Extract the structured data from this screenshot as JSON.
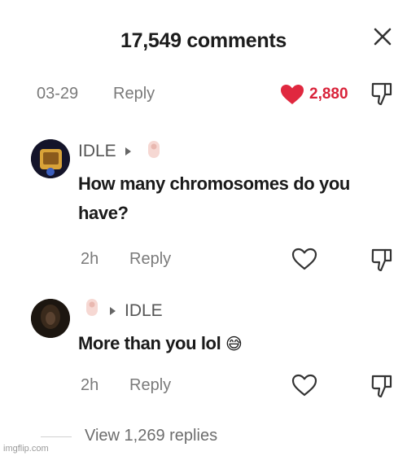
{
  "header": {
    "title": "17,549 comments"
  },
  "top_comment_footer": {
    "date": "03-29",
    "reply_label": "Reply",
    "like_count": "2,880"
  },
  "comments": [
    {
      "username": "IDLE",
      "text": "How many chromosomes do you have?",
      "time": "2h",
      "reply_label": "Reply"
    },
    {
      "username": "IDLE",
      "text": "More than you lol",
      "emoji": "😅",
      "time": "2h",
      "reply_label": "Reply"
    }
  ],
  "view_replies": "View 1,269 replies",
  "watermark": "imgflip.com",
  "icons": {
    "close": "close-icon",
    "heart": "heart-icon",
    "dislike": "dislike-icon",
    "reply_arrow": "reply-arrow-icon",
    "sticker": "sticker-icon"
  },
  "colors": {
    "heart": "#e0283f",
    "text": "#1a1a1a",
    "muted": "#7a7a7a"
  }
}
